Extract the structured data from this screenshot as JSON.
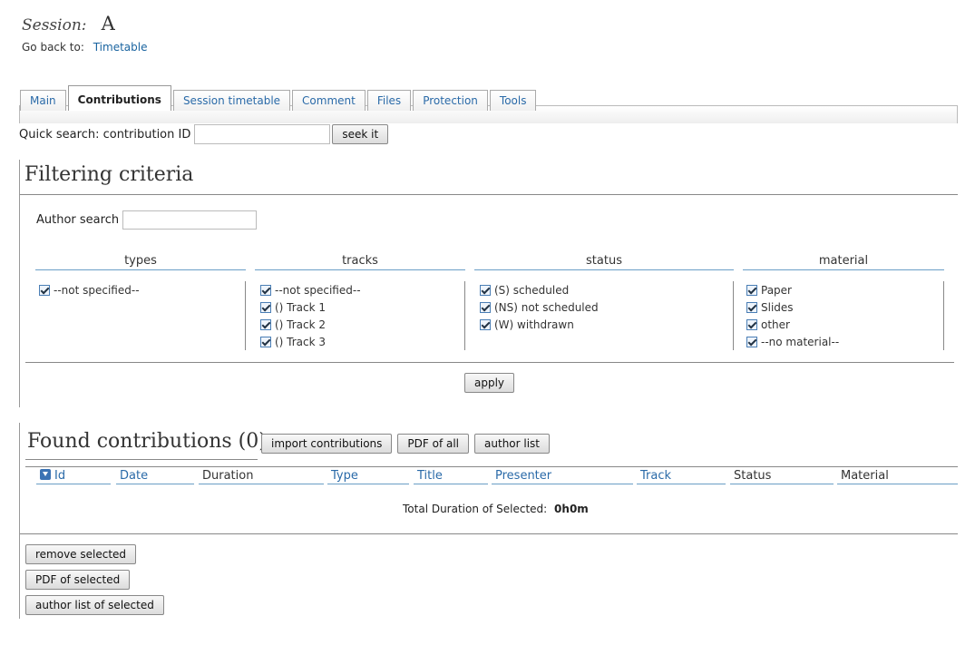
{
  "session": {
    "label": "Session:",
    "name": "A"
  },
  "goback": {
    "label": "Go back to:",
    "link": "Timetable"
  },
  "tabs": [
    {
      "label": "Main"
    },
    {
      "label": "Contributions"
    },
    {
      "label": "Session timetable"
    },
    {
      "label": "Comment"
    },
    {
      "label": "Files"
    },
    {
      "label": "Protection"
    },
    {
      "label": "Tools"
    }
  ],
  "quick_search": {
    "label": "Quick search: contribution ID",
    "value": "",
    "button": "seek it"
  },
  "filter": {
    "title": "Filtering criteria",
    "author_search_label": "Author search",
    "author_search_value": "",
    "columns": {
      "types": {
        "header": "types",
        "items": [
          "--not specified--"
        ]
      },
      "tracks": {
        "header": "tracks",
        "items": [
          "--not specified--",
          "() Track 1",
          "() Track 2",
          "() Track 3"
        ]
      },
      "status": {
        "header": "status",
        "items": [
          "(S) scheduled",
          "(NS) not scheduled",
          "(W) withdrawn"
        ]
      },
      "material": {
        "header": "material",
        "items": [
          "Paper",
          "Slides",
          "other",
          "--no material--"
        ]
      }
    },
    "apply_button": "apply"
  },
  "found": {
    "title": "Found contributions (0)",
    "buttons": {
      "import": "import contributions",
      "pdf_all": "PDF of all",
      "author_list": "author list"
    },
    "columns": {
      "id": "Id",
      "date": "Date",
      "duration": "Duration",
      "type": "Type",
      "title": "Title",
      "presenter": "Presenter",
      "track": "Track",
      "status": "Status",
      "material": "Material"
    },
    "total_label": "Total Duration of Selected:",
    "total_value": "0h0m",
    "selection_buttons": {
      "remove": "remove selected",
      "pdf": "PDF of selected",
      "author_list": "author list of selected"
    }
  },
  "colors": {
    "link": "#1a64a0",
    "column_rule": "#6a9ec6",
    "checkbox": "#4a7eb5"
  },
  "icons": {
    "checkbox": "checked-checkbox-icon",
    "sort": "sort-down-icon"
  }
}
